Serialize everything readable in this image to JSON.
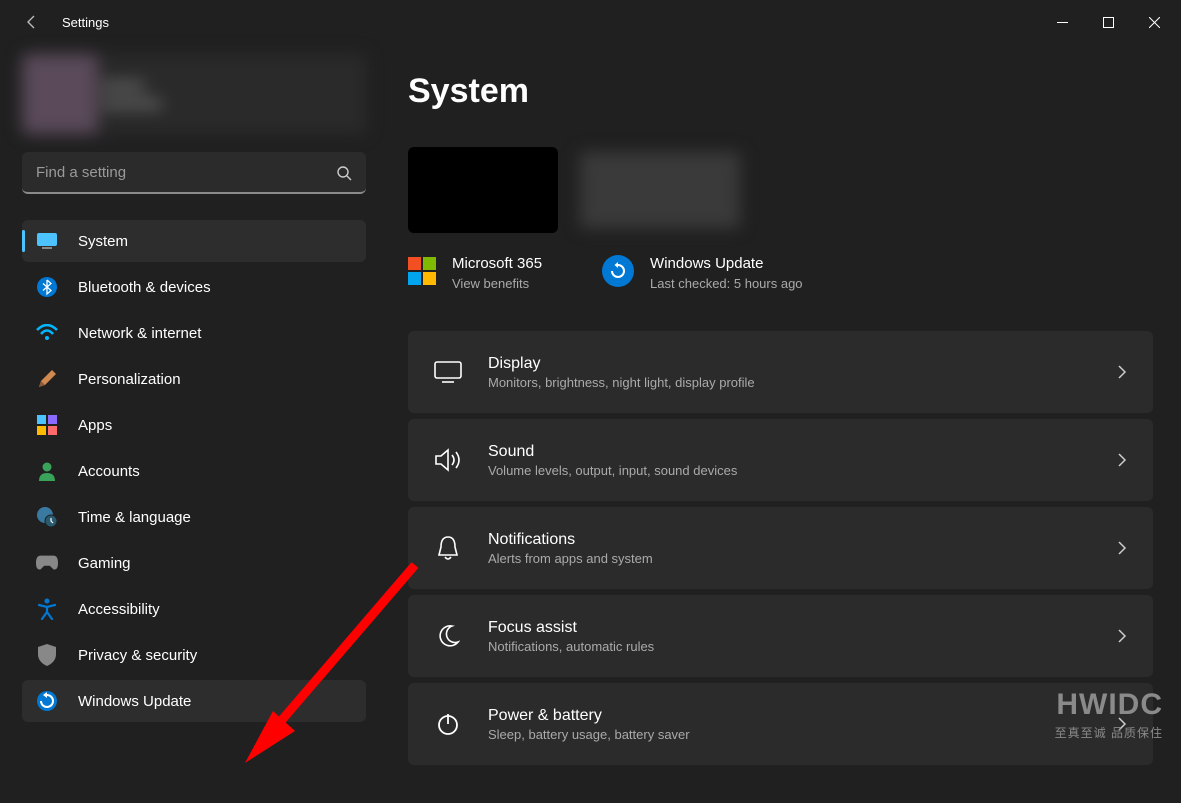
{
  "titlebar": {
    "app_title": "Settings"
  },
  "search": {
    "placeholder": "Find a setting"
  },
  "sidebar": {
    "items": [
      {
        "label": "System"
      },
      {
        "label": "Bluetooth & devices"
      },
      {
        "label": "Network & internet"
      },
      {
        "label": "Personalization"
      },
      {
        "label": "Apps"
      },
      {
        "label": "Accounts"
      },
      {
        "label": "Time & language"
      },
      {
        "label": "Gaming"
      },
      {
        "label": "Accessibility"
      },
      {
        "label": "Privacy & security"
      },
      {
        "label": "Windows Update"
      }
    ]
  },
  "main": {
    "page_title": "System",
    "cards": {
      "ms365": {
        "title": "Microsoft 365",
        "sub": "View benefits"
      },
      "wu": {
        "title": "Windows Update",
        "sub": "Last checked: 5 hours ago"
      }
    },
    "rows": [
      {
        "title": "Display",
        "sub": "Monitors, brightness, night light, display profile"
      },
      {
        "title": "Sound",
        "sub": "Volume levels, output, input, sound devices"
      },
      {
        "title": "Notifications",
        "sub": "Alerts from apps and system"
      },
      {
        "title": "Focus assist",
        "sub": "Notifications, automatic rules"
      },
      {
        "title": "Power & battery",
        "sub": "Sleep, battery usage, battery saver"
      }
    ]
  },
  "watermark": {
    "line1": "HWIDC",
    "line2": "至真至诚 品质保住"
  }
}
